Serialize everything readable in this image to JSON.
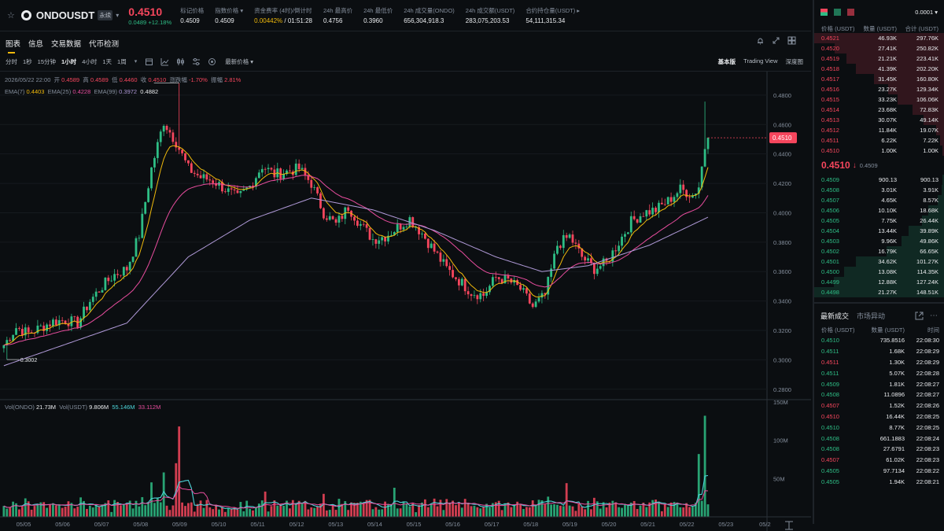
{
  "header": {
    "symbol": "ONDOUSDT",
    "contract_tag": "永续",
    "last_price": "0.4510",
    "change_abs": "0.0489",
    "change_pct": "+12.18%",
    "stats": [
      {
        "label": "标记价格",
        "value": "0.4509"
      },
      {
        "label": "指数价格 ▾",
        "value": "0.4509"
      },
      {
        "label": "资金费率 (4时)/倒计时",
        "value": "0.00442%",
        "value2": " / 01:51:28"
      },
      {
        "label": "24h 最高价",
        "value": "0.4756"
      },
      {
        "label": "24h 最低价",
        "value": "0.3960"
      },
      {
        "label": "24h 成交量(ONDO)",
        "value": "656,304,918.3"
      },
      {
        "label": "24h 成交额(USDT)",
        "value": "283,075,203.53"
      },
      {
        "label": "合约持仓量(USDT) ▸",
        "value": "54,111,315.34"
      }
    ]
  },
  "tabs": [
    "图表",
    "信息",
    "交易数据",
    "代币检测"
  ],
  "intervals": [
    "分时",
    "1秒",
    "15分钟",
    "1小时",
    "4小时",
    "1天",
    "1周"
  ],
  "price_type": "最新价格 ▾",
  "views": [
    "基本版",
    "Trading View",
    "深度图"
  ],
  "ohlc": {
    "date": "2026/05/22 22:00",
    "open_label": "开",
    "open": "0.4589",
    "high_label": "高",
    "high": "0.4589",
    "low_label": "低",
    "low": "0.4460",
    "close_label": "收",
    "close": "0.4510",
    "chg_label": "涨跌幅",
    "chg": "-1.70%",
    "amp_label": "振幅",
    "amp": "2.81%"
  },
  "ema": {
    "ema7_label": "EMA(7)",
    "ema7": "0.4403",
    "ema25_label": "EMA(25)",
    "ema25": "0.4228",
    "ema99_label": "EMA(99)",
    "ema99": "0.3972",
    "extra": "0.4882"
  },
  "chart_data": {
    "type": "candlestick",
    "y_ticks": [
      "0.4800",
      "0.4600",
      "0.4400",
      "0.4200",
      "0.4000",
      "0.3800",
      "0.3600",
      "0.3400",
      "0.3200",
      "0.3000",
      "0.2800"
    ],
    "ylim": [
      0.274,
      0.496
    ],
    "x_ticks": [
      "05/05",
      "05/06",
      "05/07",
      "05/08",
      "05/09",
      "05/10",
      "05/11",
      "05/12",
      "05/13",
      "05/14",
      "05/15",
      "05/16",
      "05/17",
      "05/18",
      "05/19",
      "05/20",
      "05/21",
      "05/22",
      "05/23",
      "05/2"
    ],
    "current_price_tag": "0.4510",
    "high_marker": "0.4882",
    "low_marker": "0.3002",
    "close_anchors": [
      [
        0,
        0.31
      ],
      [
        4,
        0.322
      ],
      [
        8,
        0.318
      ],
      [
        12,
        0.322
      ],
      [
        16,
        0.326
      ],
      [
        20,
        0.327
      ],
      [
        24,
        0.325
      ],
      [
        28,
        0.34
      ],
      [
        32,
        0.35
      ],
      [
        36,
        0.358
      ],
      [
        40,
        0.362
      ],
      [
        44,
        0.385
      ],
      [
        48,
        0.43
      ],
      [
        52,
        0.462
      ],
      [
        56,
        0.448
      ],
      [
        60,
        0.43
      ],
      [
        64,
        0.424
      ],
      [
        68,
        0.422
      ],
      [
        72,
        0.416
      ],
      [
        76,
        0.41
      ],
      [
        80,
        0.418
      ],
      [
        84,
        0.432
      ],
      [
        88,
        0.426
      ],
      [
        92,
        0.428
      ],
      [
        96,
        0.43
      ],
      [
        100,
        0.42
      ],
      [
        104,
        0.4
      ],
      [
        108,
        0.392
      ],
      [
        112,
        0.404
      ],
      [
        116,
        0.392
      ],
      [
        120,
        0.382
      ],
      [
        124,
        0.384
      ],
      [
        128,
        0.39
      ],
      [
        132,
        0.396
      ],
      [
        136,
        0.386
      ],
      [
        140,
        0.374
      ],
      [
        144,
        0.362
      ],
      [
        148,
        0.354
      ],
      [
        152,
        0.346
      ],
      [
        156,
        0.344
      ],
      [
        160,
        0.356
      ],
      [
        164,
        0.354
      ],
      [
        168,
        0.348
      ],
      [
        172,
        0.336
      ],
      [
        176,
        0.344
      ],
      [
        180,
        0.378
      ],
      [
        184,
        0.384
      ],
      [
        188,
        0.37
      ],
      [
        192,
        0.362
      ],
      [
        196,
        0.366
      ],
      [
        200,
        0.38
      ],
      [
        204,
        0.394
      ],
      [
        208,
        0.4
      ],
      [
        212,
        0.402
      ],
      [
        216,
        0.408
      ],
      [
        220,
        0.416
      ],
      [
        224,
        0.412
      ],
      [
        226,
        0.418
      ],
      [
        229,
        0.458
      ]
    ],
    "ema99_anchors": [
      [
        0,
        0.296
      ],
      [
        40,
        0.325
      ],
      [
        60,
        0.37
      ],
      [
        80,
        0.395
      ],
      [
        100,
        0.41
      ],
      [
        120,
        0.402
      ],
      [
        140,
        0.388
      ],
      [
        160,
        0.37
      ],
      [
        175,
        0.36
      ],
      [
        190,
        0.364
      ],
      [
        210,
        0.378
      ],
      [
        229,
        0.397
      ]
    ],
    "volume": {
      "labels": {
        "v1_label": "Vol(ONDO)",
        "v1": "21.73M",
        "v2_label": "Vol(USDT)",
        "v2": "9.806M",
        "ma1": "55.146M",
        "ma2": "33.112M"
      },
      "y_ticks": [
        "150M",
        "100M",
        "50M"
      ],
      "ylim": [
        0,
        152
      ],
      "spikes": [
        [
          52,
          58
        ],
        [
          57,
          118
        ],
        [
          56,
          70
        ],
        [
          48,
          45
        ],
        [
          85,
          33
        ],
        [
          104,
          30
        ],
        [
          127,
          38
        ],
        [
          183,
          44
        ],
        [
          226,
          82
        ],
        [
          228,
          132
        ]
      ]
    }
  },
  "right": {
    "precision": "0.0001 ▾",
    "cols": [
      "价格 (USDT)",
      "数量 (USDT)",
      "合计 (USDT)"
    ],
    "asks": [
      [
        "0.4521",
        "46.93K",
        "297.76K",
        1.0
      ],
      [
        "0.4520",
        "27.41K",
        "250.82K",
        0.84
      ],
      [
        "0.4519",
        "21.21K",
        "223.41K",
        0.75
      ],
      [
        "0.4518",
        "41.39K",
        "202.20K",
        0.68
      ],
      [
        "0.4517",
        "31.45K",
        "160.80K",
        0.54
      ],
      [
        "0.4516",
        "23.27K",
        "129.34K",
        0.43
      ],
      [
        "0.4515",
        "33.23K",
        "106.06K",
        0.36
      ],
      [
        "0.4514",
        "23.68K",
        "72.83K",
        0.24
      ],
      [
        "0.4513",
        "30.07K",
        "49.14K",
        0.16
      ],
      [
        "0.4512",
        "11.84K",
        "19.07K",
        0.06
      ],
      [
        "0.4511",
        "6.22K",
        "7.22K",
        0.03
      ],
      [
        "0.4510",
        "1.00K",
        "1.00K",
        0.01
      ]
    ],
    "mid_price": "0.4510",
    "mid_arrow": "↓",
    "mid_mark": "0.4509",
    "bids": [
      [
        "0.4509",
        "900.13",
        "900.13",
        0.01
      ],
      [
        "0.4508",
        "3.01K",
        "3.91K",
        0.02
      ],
      [
        "0.4507",
        "4.65K",
        "8.57K",
        0.05
      ],
      [
        "0.4506",
        "10.10K",
        "18.68K",
        0.12
      ],
      [
        "0.4505",
        "7.75K",
        "26.44K",
        0.17
      ],
      [
        "0.4504",
        "13.44K",
        "39.89K",
        0.27
      ],
      [
        "0.4503",
        "9.96K",
        "49.86K",
        0.33
      ],
      [
        "0.4502",
        "16.79K",
        "66.65K",
        0.44
      ],
      [
        "0.4501",
        "34.62K",
        "101.27K",
        0.68
      ],
      [
        "0.4500",
        "13.08K",
        "114.35K",
        0.77
      ],
      [
        "0.4499",
        "12.88K",
        "127.24K",
        0.85
      ],
      [
        "0.4498",
        "21.27K",
        "148.51K",
        1.0
      ]
    ],
    "trade_tabs": [
      "最新成交",
      "市场异动"
    ],
    "trade_cols": [
      "价格 (USDT)",
      "数量 (USDT)",
      "时间"
    ],
    "trades": [
      [
        "0.4510",
        "735.8516",
        "22:08:30",
        "up"
      ],
      [
        "0.4511",
        "1.68K",
        "22:08:29",
        "up"
      ],
      [
        "0.4511",
        "1.30K",
        "22:08:29",
        "dn"
      ],
      [
        "0.4511",
        "5.07K",
        "22:08:28",
        "up"
      ],
      [
        "0.4509",
        "1.81K",
        "22:08:27",
        "up"
      ],
      [
        "0.4508",
        "11.0896",
        "22:08:27",
        "up"
      ],
      [
        "0.4507",
        "1.52K",
        "22:08:26",
        "dn"
      ],
      [
        "0.4510",
        "16.44K",
        "22:08:25",
        "dn"
      ],
      [
        "0.4510",
        "8.77K",
        "22:08:25",
        "up"
      ],
      [
        "0.4508",
        "661.1883",
        "22:08:24",
        "up"
      ],
      [
        "0.4508",
        "27.6791",
        "22:08:23",
        "up"
      ],
      [
        "0.4507",
        "61.02K",
        "22:08:23",
        "dn"
      ],
      [
        "0.4505",
        "97.7134",
        "22:08:22",
        "up"
      ],
      [
        "0.4505",
        "1.94K",
        "22:08:21",
        "up"
      ]
    ]
  }
}
